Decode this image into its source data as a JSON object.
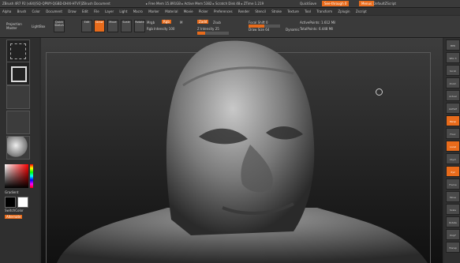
{
  "titlebar": {
    "app": "ZBrush 4R7 P2 (x64)[SQ-QPWY-QGBD-DHXI-HTVF]ZBrush Document",
    "mem": "▸ Free Mem 15.891GB ▸ Active Mem 5382 ▸ Scratch Disk 48 ▸ ZTime 1.219",
    "quicksave": "QuickSave",
    "seethrough": "See-through 0",
    "menus_btn": "Menus",
    "defaultzscript": "DefaultZScript"
  },
  "menubar": {
    "items": [
      "Alpha",
      "Brush",
      "Color",
      "Document",
      "Draw",
      "Edit",
      "File",
      "Layer",
      "Light",
      "Macro",
      "Marker",
      "Material",
      "Movie",
      "Picker",
      "Preferences",
      "Render",
      "Stencil",
      "Stroke",
      "Texture",
      "Tool",
      "Transform",
      "Zplugin",
      "Zscript"
    ]
  },
  "toolbar": {
    "projection_master": "Projection Master",
    "lightbox": "LightBox",
    "quick_sketch": "Quick Sketch",
    "edit": "Edit",
    "draw": "Draw",
    "move": "Move",
    "scale": "Scale",
    "rotate": "Rotate",
    "mrgb": "Mrgb",
    "rgb": "Rgb",
    "m": "M",
    "rgb_intensity": "Rgb Intensity 100",
    "zadd": "Zadd",
    "zsub": "Zsub",
    "z_intensity": "Z Intensity 25",
    "focal_shift": "Focal Shift 0",
    "draw_size": "Draw Size 64",
    "dynamic": "Dynamic",
    "active_points": "ActivePoints: 1.612 Mil",
    "total_points": "TotalPoints: 6.448 Mil"
  },
  "leftshelf": {
    "gradient": "Gradient",
    "switchcolor": "SwitchColor",
    "alternate": "Alternate"
  },
  "rightshelf": {
    "items": [
      "BPR",
      "SPix 3",
      "Scroll",
      "Zoom",
      "Actual",
      "AAHalf",
      "Persp",
      "Floor",
      "Local",
      "LSym",
      "Xyz",
      "Frame",
      "Move",
      "Scale",
      "Rotate",
      "PolyF",
      "Transp"
    ]
  }
}
